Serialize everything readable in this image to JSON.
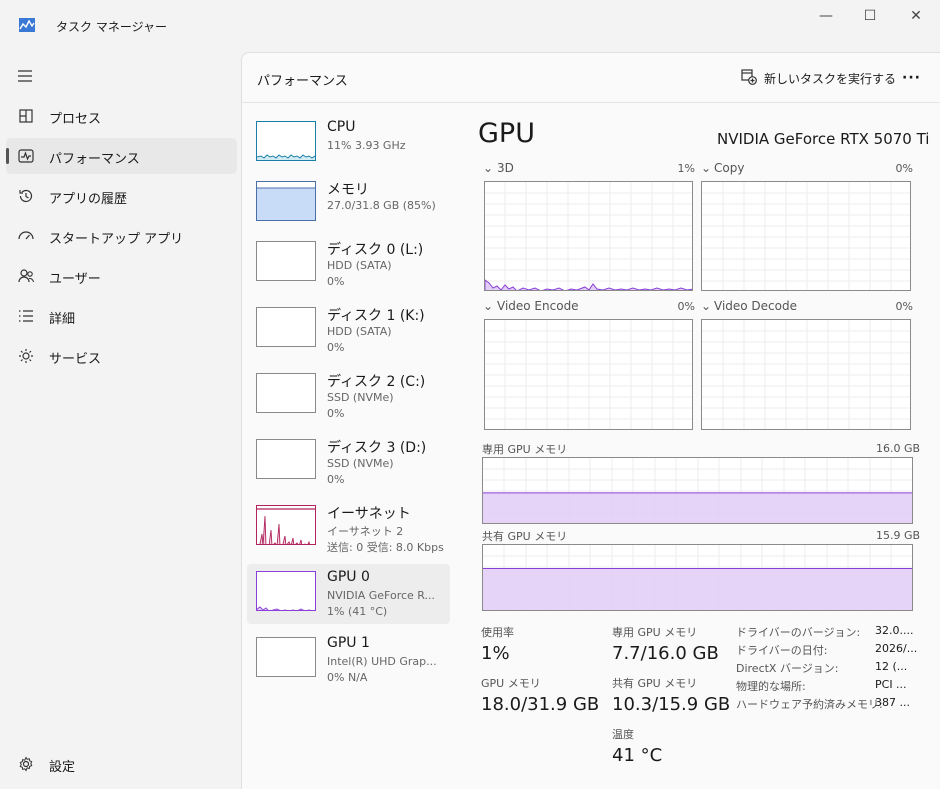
{
  "window": {
    "title": "タスク マネージャー",
    "controls": {
      "minimize": "—",
      "maximize": "☐",
      "close": "✕"
    }
  },
  "sidebar": {
    "items": [
      {
        "label": "プロセス",
        "icon": "processes-icon"
      },
      {
        "label": "パフォーマンス",
        "icon": "performance-icon",
        "selected": true
      },
      {
        "label": "アプリの履歴",
        "icon": "app-history-icon"
      },
      {
        "label": "スタートアップ アプリ",
        "icon": "startup-icon"
      },
      {
        "label": "ユーザー",
        "icon": "users-icon"
      },
      {
        "label": "詳細",
        "icon": "details-icon"
      },
      {
        "label": "サービス",
        "icon": "services-icon"
      }
    ],
    "settings": {
      "label": "設定",
      "icon": "gear-icon"
    }
  },
  "header": {
    "title": "パフォーマンス",
    "new_task_label": "新しいタスクを実行する",
    "more": "···"
  },
  "devices": [
    {
      "name": "CPU",
      "line2": "11%  3.93 GHz",
      "line3": ""
    },
    {
      "name": "メモリ",
      "line2": "27.0/31.8 GB (85%)",
      "line3": ""
    },
    {
      "name": "ディスク 0 (L:)",
      "line2": "HDD (SATA)",
      "line3": "0%"
    },
    {
      "name": "ディスク 1 (K:)",
      "line2": "HDD (SATA)",
      "line3": "0%"
    },
    {
      "name": "ディスク 2 (C:)",
      "line2": "SSD (NVMe)",
      "line3": "0%"
    },
    {
      "name": "ディスク 3 (D:)",
      "line2": "SSD (NVMe)",
      "line3": "0%"
    },
    {
      "name": "イーサネット",
      "line2": "イーサネット 2",
      "line3": "送信: 0  受信: 8.0 Kbps"
    },
    {
      "name": "GPU 0",
      "line2": "NVIDIA GeForce R...",
      "line3": "1% (41 °C)",
      "selected": true
    },
    {
      "name": "GPU 1",
      "line2": "Intel(R) UHD Grap...",
      "line3": "0%  N/A"
    }
  ],
  "gpu": {
    "title": "GPU",
    "model": "NVIDIA GeForce RTX 5070 Ti",
    "engines": [
      {
        "label": "3D",
        "pct": "1%"
      },
      {
        "label": "Copy",
        "pct": "0%"
      },
      {
        "label": "Video Encode",
        "pct": "0%"
      },
      {
        "label": "Video Decode",
        "pct": "0%"
      }
    ],
    "dedicated_mem": {
      "label": "専用 GPU メモリ",
      "max": "16.0 GB",
      "fill": 0.48
    },
    "shared_mem": {
      "label": "共有 GPU メモリ",
      "max": "15.9 GB",
      "fill": 0.65
    },
    "stats": {
      "usage_label": "使用率",
      "usage": "1%",
      "gpu_mem_label": "GPU メモリ",
      "gpu_mem": "18.0/31.9 GB",
      "dedicated_label": "専用 GPU メモリ",
      "dedicated": "7.7/16.0 GB",
      "shared_label": "共有 GPU メモリ",
      "shared": "10.3/15.9 GB",
      "temp_label": "温度",
      "temp": "41 °C"
    },
    "info": [
      {
        "label": "ドライバーのバージョン:",
        "value": "32.0...."
      },
      {
        "label": "ドライバーの日付:",
        "value": "2026/..."
      },
      {
        "label": "DirectX バージョン:",
        "value": "12 (..."
      },
      {
        "label": "物理的な場所:",
        "value": "PCI ..."
      },
      {
        "label": "ハードウェア予約済みメモリ:",
        "value": "387 ..."
      }
    ]
  },
  "colors": {
    "accent_gpu": "#8a3fd8",
    "gpu_fill": "#e2cdf7",
    "cpu_line": "#1a7fa8",
    "mem_fill": "#c9dcf7",
    "net_line": "#b0245c"
  }
}
